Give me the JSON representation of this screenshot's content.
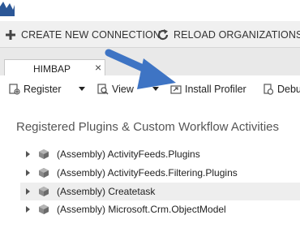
{
  "command_bar": {
    "create_label": "CREATE NEW CONNECTION",
    "reload_label": "RELOAD ORGANIZATIONS"
  },
  "tab": {
    "label": "HIMBAP",
    "close_symbol": "×"
  },
  "toolbar": {
    "register_label": "Register",
    "view_label": "View",
    "install_profiler_label": "Install Profiler",
    "debug_label": "Debu"
  },
  "main": {
    "heading": "Registered Plugins & Custom Workflow Activities",
    "assemblies": [
      {
        "label": "(Assembly) ActivityFeeds.Plugins",
        "selected": false
      },
      {
        "label": "(Assembly) ActivityFeeds.Filtering.Plugins",
        "selected": false
      },
      {
        "label": "(Assembly) Createtask",
        "selected": true
      },
      {
        "label": "(Assembly) Microsoft.Crm.ObjectModel",
        "selected": false
      }
    ]
  },
  "icons": {
    "logo": "dynamics-logo-icon",
    "create": "plus-icon",
    "reload": "refresh-icon",
    "register": "register-icon",
    "view": "magnifier-icon",
    "install_profiler": "install-profiler-icon",
    "debug": "debug-icon",
    "assembly": "assembly-cube-icon",
    "annotation": "callout-arrow-icon"
  },
  "colors": {
    "annotation_arrow": "#3e74c4",
    "command_bar_bg": "#f0f0f0",
    "selected_row_bg": "#eeeeee",
    "logo": "#2b5797"
  }
}
